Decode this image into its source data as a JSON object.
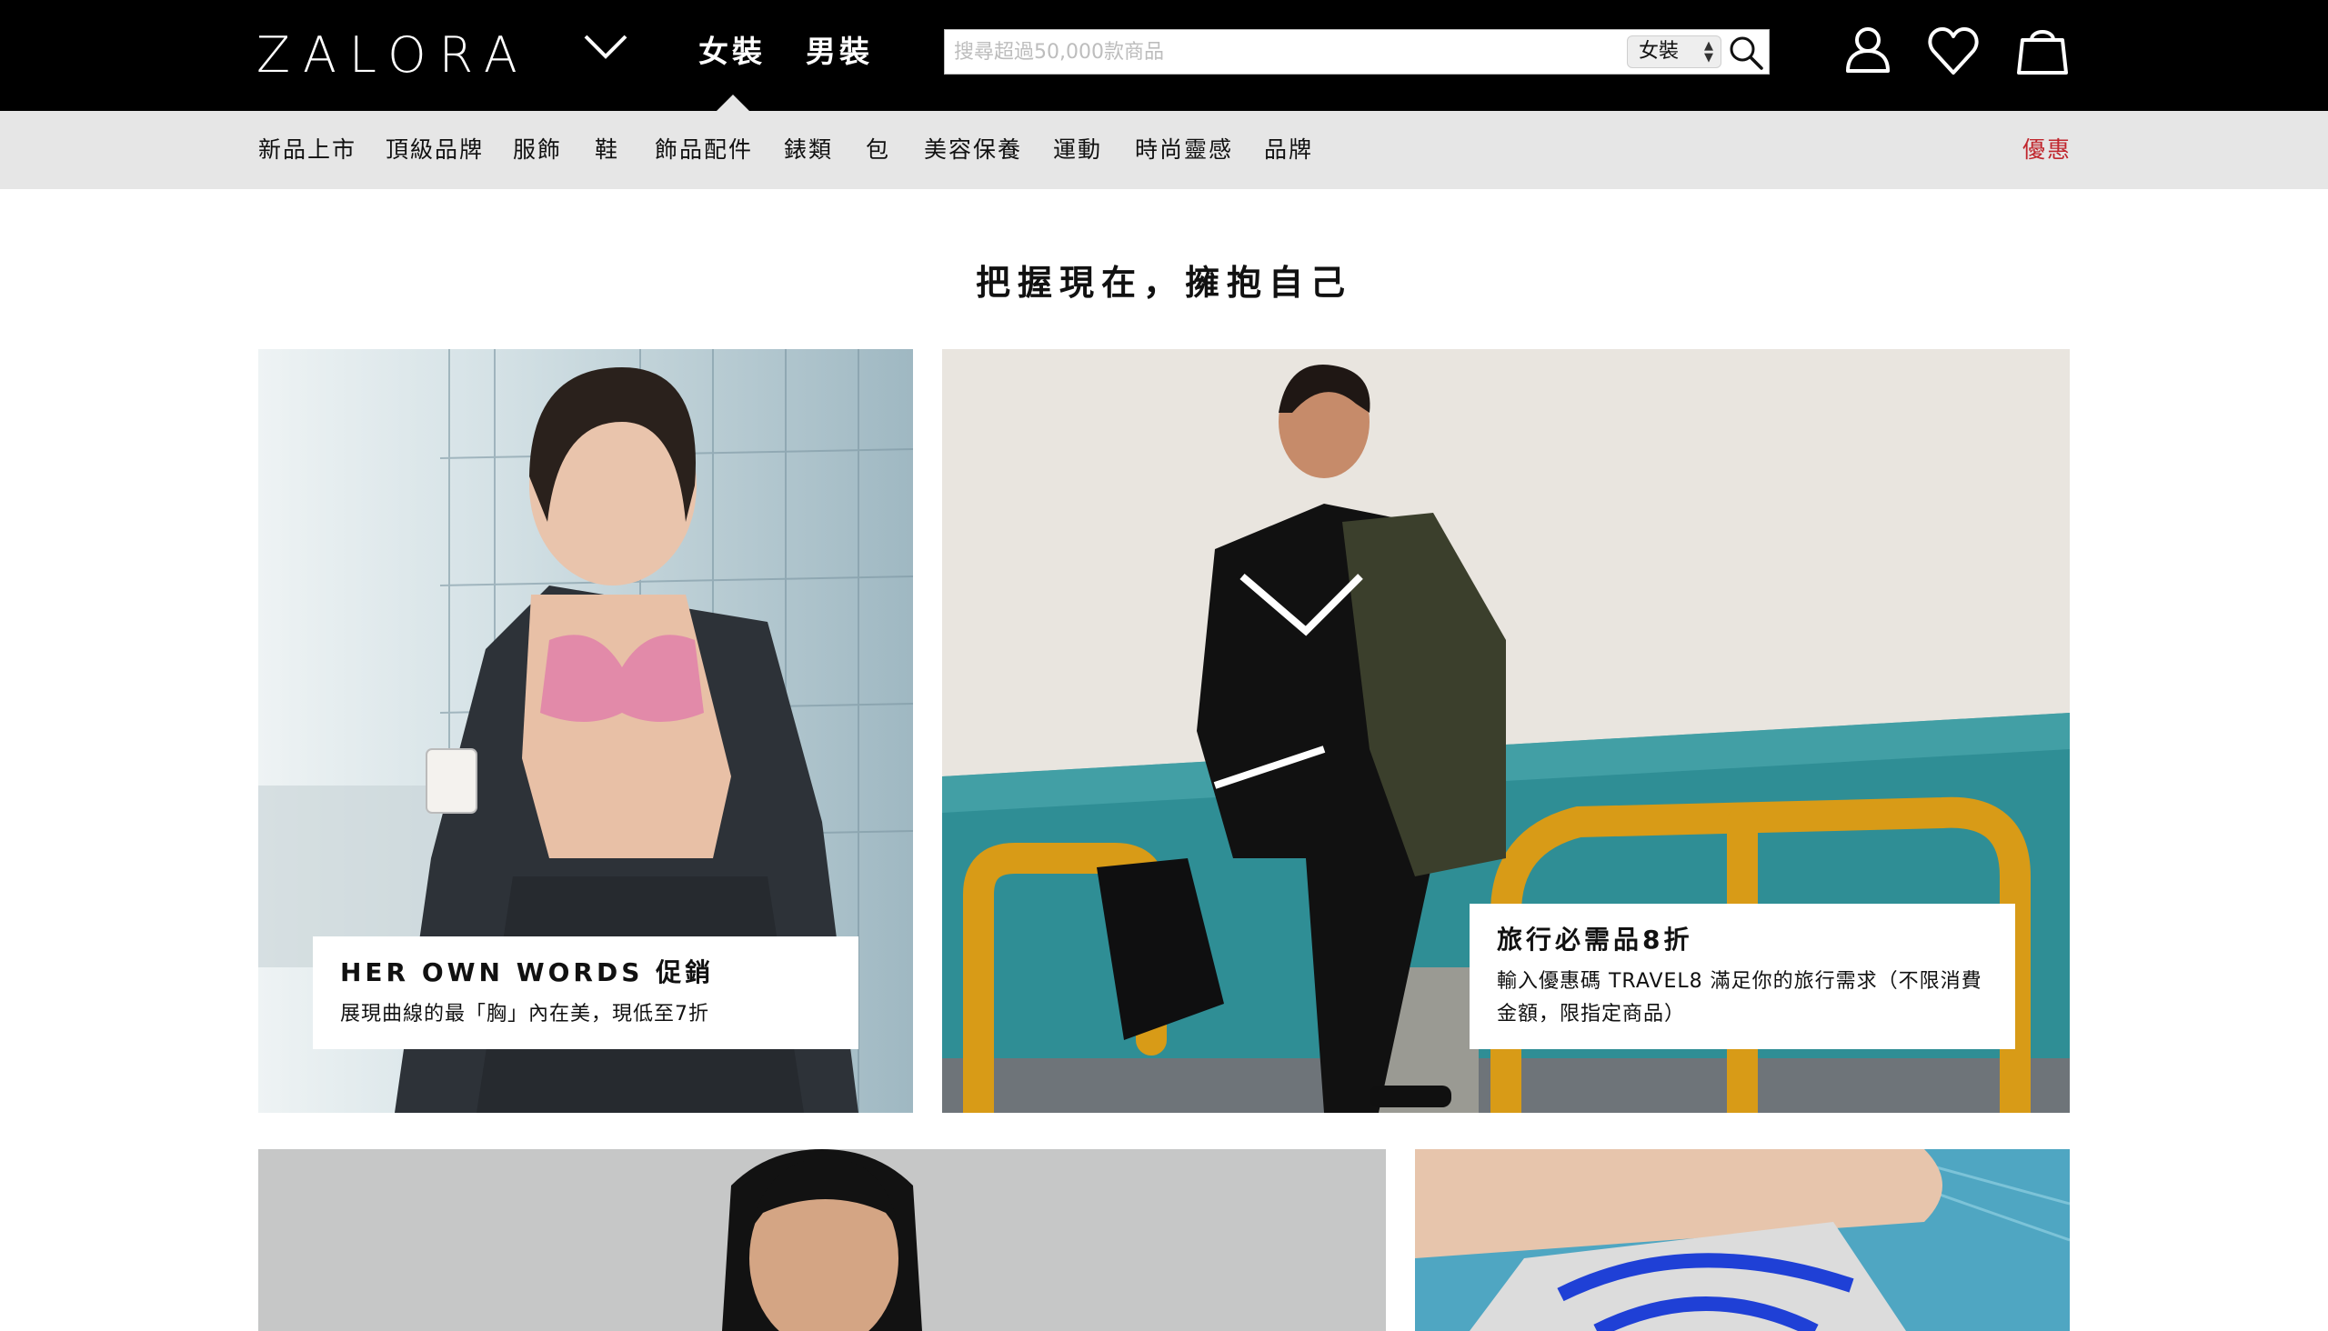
{
  "header": {
    "logo": "ZALORA",
    "tabs": [
      {
        "label": "女裝"
      },
      {
        "label": "男裝"
      }
    ],
    "search": {
      "placeholder": "搜尋超過50,000款商品",
      "scope": "女裝"
    }
  },
  "nav": {
    "items": [
      "新品上市",
      "頂級品牌",
      "服飾",
      "鞋",
      "飾品配件",
      "錶類",
      "包",
      "美容保養",
      "運動",
      "時尚靈感",
      "品牌"
    ],
    "promo": "優惠"
  },
  "headline": "把握現在，擁抱自己",
  "banners": [
    {
      "title": "HER OWN WORDS 促銷",
      "text": "展現曲線的最「胸」內在美，現低至7折"
    },
    {
      "title": "旅行必需品8折",
      "text": "輸入優惠碼 TRAVEL8 滿足你的旅行需求（不限消費金額，限指定商品）"
    }
  ],
  "colors": {
    "header_bg": "#000000",
    "nav_bg": "#e6e6e6",
    "promo": "#c0262d"
  }
}
